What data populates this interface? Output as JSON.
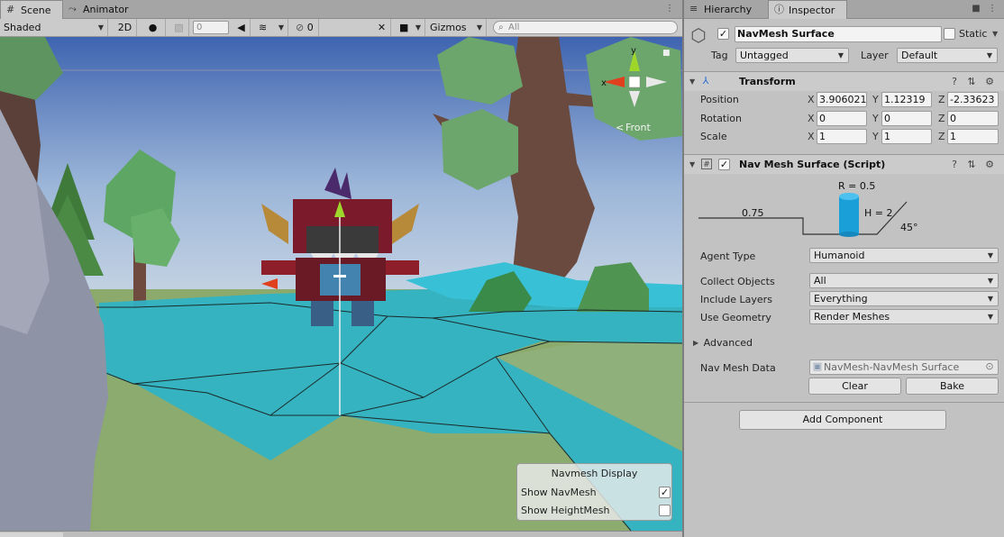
{
  "scene_panel": {
    "tabs": [
      {
        "label": "Scene",
        "icon": "grid-icon"
      },
      {
        "label": "Animator",
        "icon": "animator-icon"
      }
    ],
    "toolbar": {
      "shading_mode": "Shaded",
      "mode_2d": "2D",
      "effects_count": "0",
      "hidden_count": "0",
      "gizmos": "Gizmos",
      "search_placeholder": "All"
    },
    "gizmo_labels": {
      "x": "x",
      "y": "y",
      "view": "Front"
    },
    "navmesh_display": {
      "title": "Navmesh Display",
      "show_navmesh": {
        "label": "Show NavMesh",
        "checked": true
      },
      "show_heightmesh": {
        "label": "Show HeightMesh",
        "checked": false
      }
    }
  },
  "inspector": {
    "tabs": [
      {
        "label": "Hierarchy",
        "icon": "hierarchy-icon"
      },
      {
        "label": "Inspector",
        "icon": "info-icon"
      }
    ],
    "object": {
      "active": true,
      "name": "NavMesh Surface",
      "static_label": "Static",
      "static": false,
      "tag_label": "Tag",
      "tag": "Untagged",
      "layer_label": "Layer",
      "layer": "Default"
    },
    "transform": {
      "title": "Transform",
      "position": {
        "label": "Position",
        "x": "3.906021",
        "y": "1.12319",
        "z": "-2.33623"
      },
      "rotation": {
        "label": "Rotation",
        "x": "0",
        "y": "0",
        "z": "0"
      },
      "scale": {
        "label": "Scale",
        "x": "1",
        "y": "1",
        "z": "1"
      }
    },
    "navmesh_surface": {
      "title": "Nav Mesh Surface (Script)",
      "enabled": true,
      "diagram": {
        "radius": "R = 0.5",
        "height": "H = 2",
        "step": "0.75",
        "slope": "45°"
      },
      "agent_type": {
        "label": "Agent Type",
        "value": "Humanoid"
      },
      "collect_objects": {
        "label": "Collect Objects",
        "value": "All"
      },
      "include_layers": {
        "label": "Include Layers",
        "value": "Everything"
      },
      "use_geometry": {
        "label": "Use Geometry",
        "value": "Render Meshes"
      },
      "advanced_label": "Advanced",
      "navmesh_data": {
        "label": "Nav Mesh Data",
        "value": "NavMesh-NavMesh Surface"
      },
      "clear_label": "Clear",
      "bake_label": "Bake"
    },
    "add_component_label": "Add Component"
  },
  "axis_letters": {
    "x": "X",
    "y": "Y",
    "z": "Z"
  },
  "colors": {
    "navmesh": "#2fb4c8",
    "sky_top": "#4a6fb4",
    "ground": "#87a66a",
    "accent_arrow_y": "#9fd62b",
    "accent_arrow_x": "#e0401e"
  }
}
